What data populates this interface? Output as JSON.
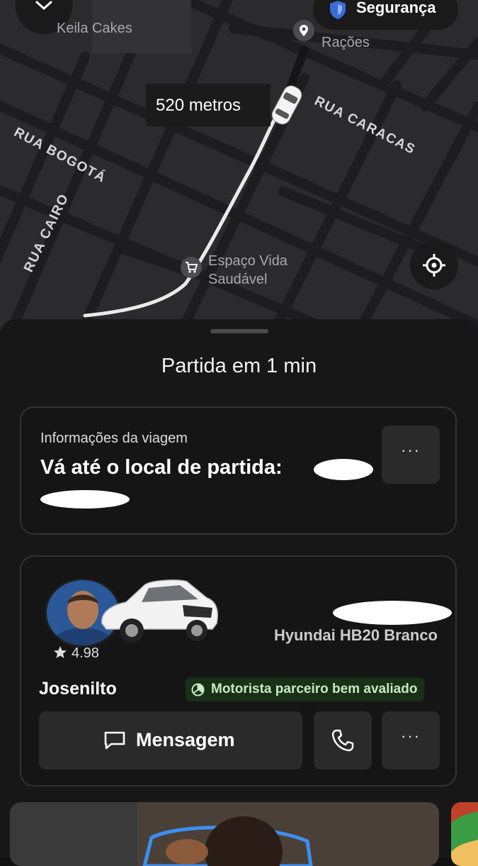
{
  "map": {
    "distance": "520 metros",
    "places": [
      "Keila Cakes",
      "Rações",
      "Espaço Vida",
      "Saudável"
    ],
    "streets": [
      "RUA CARACAS",
      "RUA BOGOTÁ",
      "RUA CAIRO"
    ],
    "safety_label": "Segurança"
  },
  "sheet": {
    "title": "Partida em 1 min",
    "trip_info": {
      "label": "Informações da viagem",
      "instruction": "Vá até o local de partida:",
      "more": "···"
    },
    "driver": {
      "rating": "4.98",
      "vehicle": "Hyundai HB20 Branco",
      "name": "Josenilto",
      "badge": "Motorista parceiro bem avaliado",
      "message_label": "Mensagem",
      "more": "···"
    }
  }
}
